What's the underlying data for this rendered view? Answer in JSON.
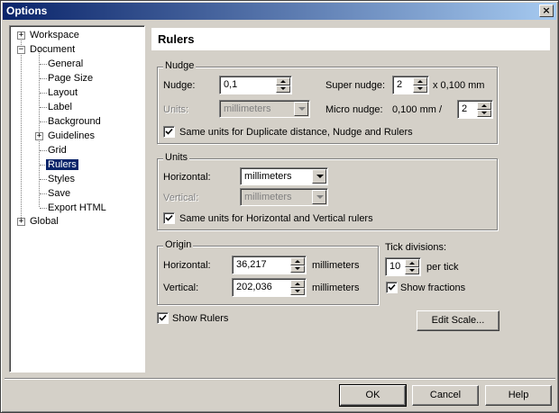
{
  "window": {
    "title": "Options",
    "close_glyph": "×"
  },
  "tree": {
    "items": [
      {
        "label": "Workspace"
      },
      {
        "label": "Document"
      },
      {
        "label": "General"
      },
      {
        "label": "Page Size"
      },
      {
        "label": "Layout"
      },
      {
        "label": "Label"
      },
      {
        "label": "Background"
      },
      {
        "label": "Guidelines"
      },
      {
        "label": "Grid"
      },
      {
        "label": "Rulers"
      },
      {
        "label": "Styles"
      },
      {
        "label": "Save"
      },
      {
        "label": "Export HTML"
      },
      {
        "label": "Global"
      }
    ],
    "selected": "Rulers"
  },
  "page": {
    "title": "Rulers"
  },
  "nudge": {
    "group_label": "Nudge",
    "nudge_label": "Nudge:",
    "nudge_value": "0,1",
    "units_label": "Units:",
    "units_value": "millimeters",
    "super_label": "Super nudge:",
    "super_value": "2",
    "super_suffix": "x 0,100 mm",
    "micro_label": "Micro nudge:",
    "micro_prefix": "0,100 mm /",
    "micro_value": "2",
    "same_units_label": "Same units for Duplicate distance, Nudge and Rulers",
    "same_units_checked": true
  },
  "units": {
    "group_label": "Units",
    "horizontal_label": "Horizontal:",
    "horizontal_value": "millimeters",
    "vertical_label": "Vertical:",
    "vertical_value": "millimeters",
    "same_units_label": "Same units for Horizontal and Vertical rulers",
    "same_units_checked": true
  },
  "origin": {
    "group_label": "Origin",
    "horizontal_label": "Horizontal:",
    "horizontal_value": "36,217",
    "horizontal_unit": "millimeters",
    "vertical_label": "Vertical:",
    "vertical_value": "202,036",
    "vertical_unit": "millimeters"
  },
  "ticks": {
    "label": "Tick divisions:",
    "value": "10",
    "suffix": "per tick",
    "show_fractions_label": "Show fractions",
    "show_fractions_checked": true
  },
  "show_rulers": {
    "label": "Show Rulers",
    "checked": true
  },
  "buttons": {
    "edit_scale": "Edit Scale...",
    "ok": "OK",
    "cancel": "Cancel",
    "help": "Help"
  }
}
